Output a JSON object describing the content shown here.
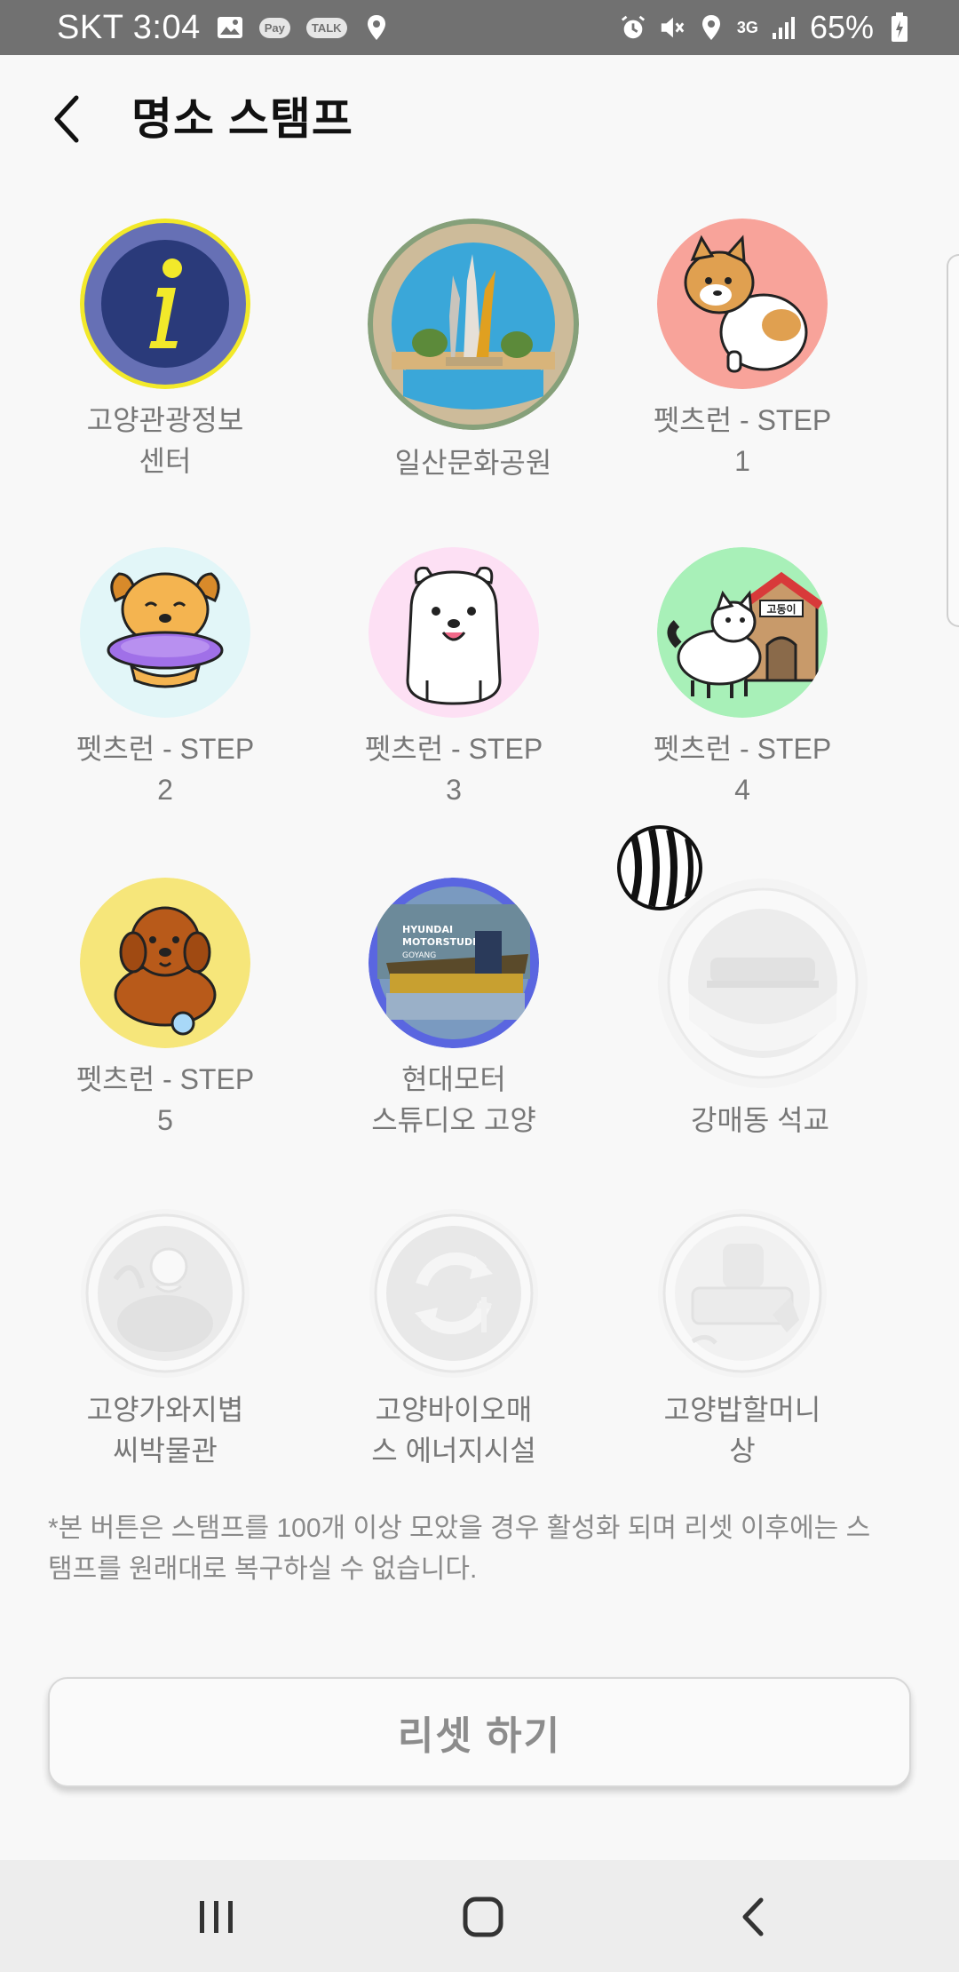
{
  "status_bar": {
    "carrier_time": "SKT 3:04",
    "pay_label": "Pay",
    "talk_label": "TALK",
    "network": "3G",
    "battery": "65%"
  },
  "header": {
    "title": "명소 스탬프"
  },
  "stamps": [
    {
      "label": "고양관광정보\n센터",
      "collected": true,
      "icon": "info-icon"
    },
    {
      "label": "일산문화공원",
      "collected": true,
      "icon": "monument-icon"
    },
    {
      "label": "펫츠런 - STEP\n1",
      "collected": true,
      "icon": "shiba-dog-icon"
    },
    {
      "label": "펫츠런 - STEP\n2",
      "collected": true,
      "icon": "golden-dog-frisbee-icon"
    },
    {
      "label": "펫츠런 - STEP\n3",
      "collected": true,
      "icon": "white-dog-icon"
    },
    {
      "label": "펫츠런 - STEP\n4",
      "collected": true,
      "icon": "jindo-dog-house-icon"
    },
    {
      "label": "펫츠런 - STEP\n5",
      "collected": true,
      "icon": "poodle-dog-icon"
    },
    {
      "label": "현대모터\n스튜디오 고양",
      "collected": true,
      "icon": "motorstudio-icon"
    },
    {
      "label": "강매동 석교",
      "collected": false,
      "icon": "stone-bridge-icon"
    },
    {
      "label": "고양가와지볍\n씨박물관",
      "collected": false,
      "icon": "rice-museum-icon"
    },
    {
      "label": "고양바이오매\n스 에너지시설",
      "collected": false,
      "icon": "recycle-energy-icon"
    },
    {
      "label": "고양밥할머니\n상",
      "collected": false,
      "icon": "grandmother-statue-icon"
    }
  ],
  "motorstudio_text": [
    "HYUNDAI",
    "MOTORSTUDIO",
    "GOYANG"
  ],
  "doghouse_text": "고동이",
  "notice": "*본 버튼은 스탬프를 100개 이상 모았을 경우 활성화 되며 리셋 이후에는 스탬프를 원래대로 복구하실 수 없습니다.",
  "reset_button": "리셋 하기",
  "colors": {
    "status_bar": "#717171",
    "collected_label": "#777777",
    "locked_label": "#777777",
    "notice_text": "#8a8a8a",
    "info_navy": "#2a3a7a",
    "info_yellow": "#f2e92a"
  }
}
